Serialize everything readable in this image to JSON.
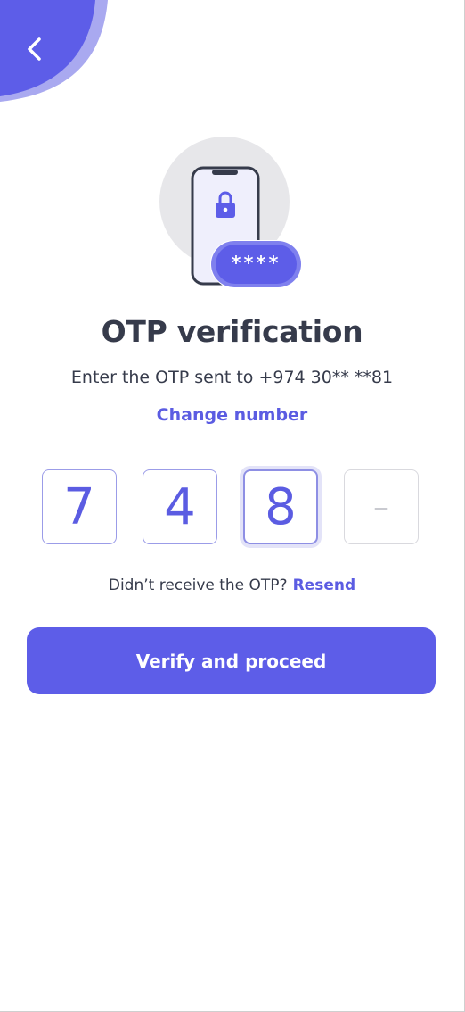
{
  "header": {
    "back_icon": "chevron-left-icon"
  },
  "illustration": {
    "lock_icon": "lock-icon",
    "masked_code": "****"
  },
  "title": "OTP verification",
  "subtitle": "Enter the OTP sent to +974 30** **81",
  "change_number_label": "Change number",
  "otp": {
    "digits": [
      "7",
      "4",
      "8",
      "–"
    ]
  },
  "resend": {
    "prompt": "Didn’t receive the OTP?",
    "link_label": "Resend"
  },
  "verify_button_label": "Verify and proceed",
  "colors": {
    "accent": "#5d5de8",
    "text_dark": "#363b4b",
    "blob_light": "#a9a9f0"
  }
}
